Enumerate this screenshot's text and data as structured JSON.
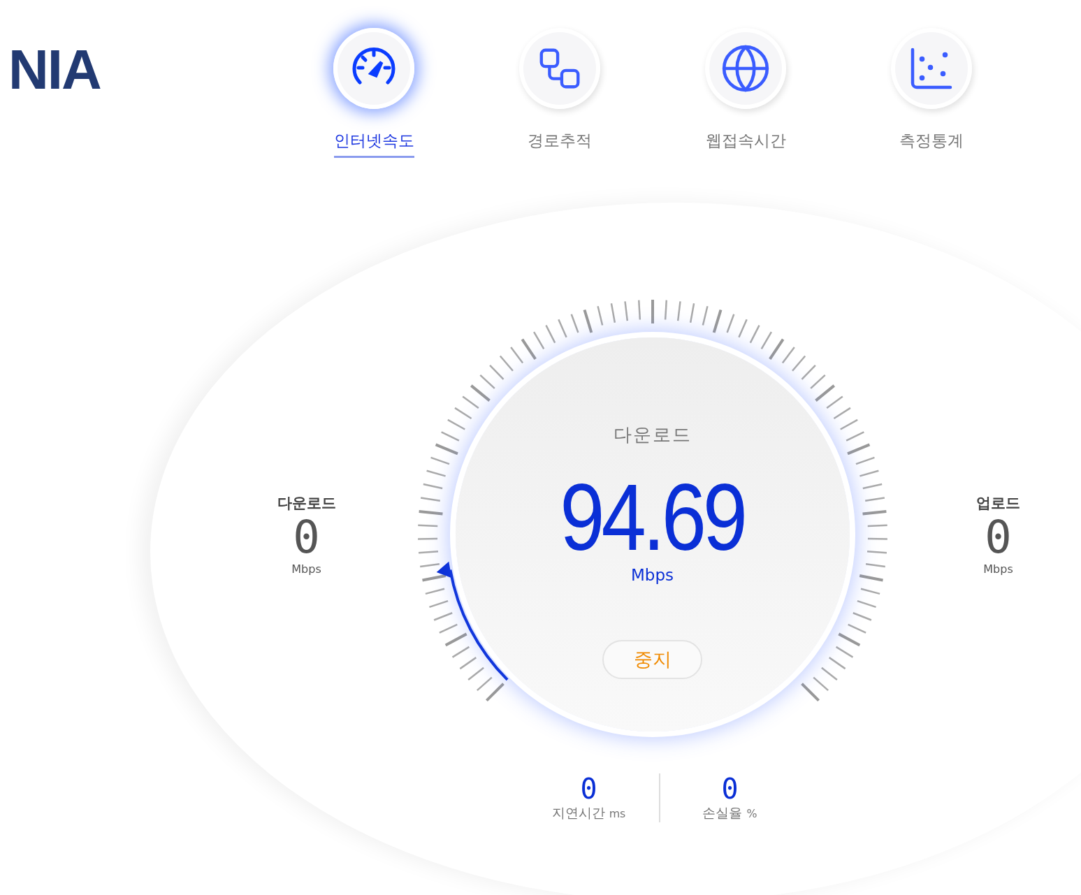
{
  "logo": "NIA",
  "tabs": [
    {
      "label": "인터넷속도",
      "kind": "speed",
      "selected": true
    },
    {
      "label": "경로추적",
      "kind": "route",
      "selected": false
    },
    {
      "label": "웹접속시간",
      "kind": "web",
      "selected": false
    },
    {
      "label": "측정통계",
      "kind": "stats",
      "selected": false
    }
  ],
  "gauge": {
    "title": "다운로드",
    "value": "94.69",
    "unit": "Mbps",
    "level": 0.13,
    "stop_button": "중지"
  },
  "download": {
    "label": "다운로드",
    "value": "0",
    "unit": "Mbps"
  },
  "upload": {
    "label": "업로드",
    "value": "0",
    "unit": "Mbps"
  },
  "latency": {
    "value": "0",
    "label": "지연시간",
    "unit": "ms"
  },
  "loss": {
    "value": "0",
    "label": "손실율",
    "unit": "%"
  }
}
